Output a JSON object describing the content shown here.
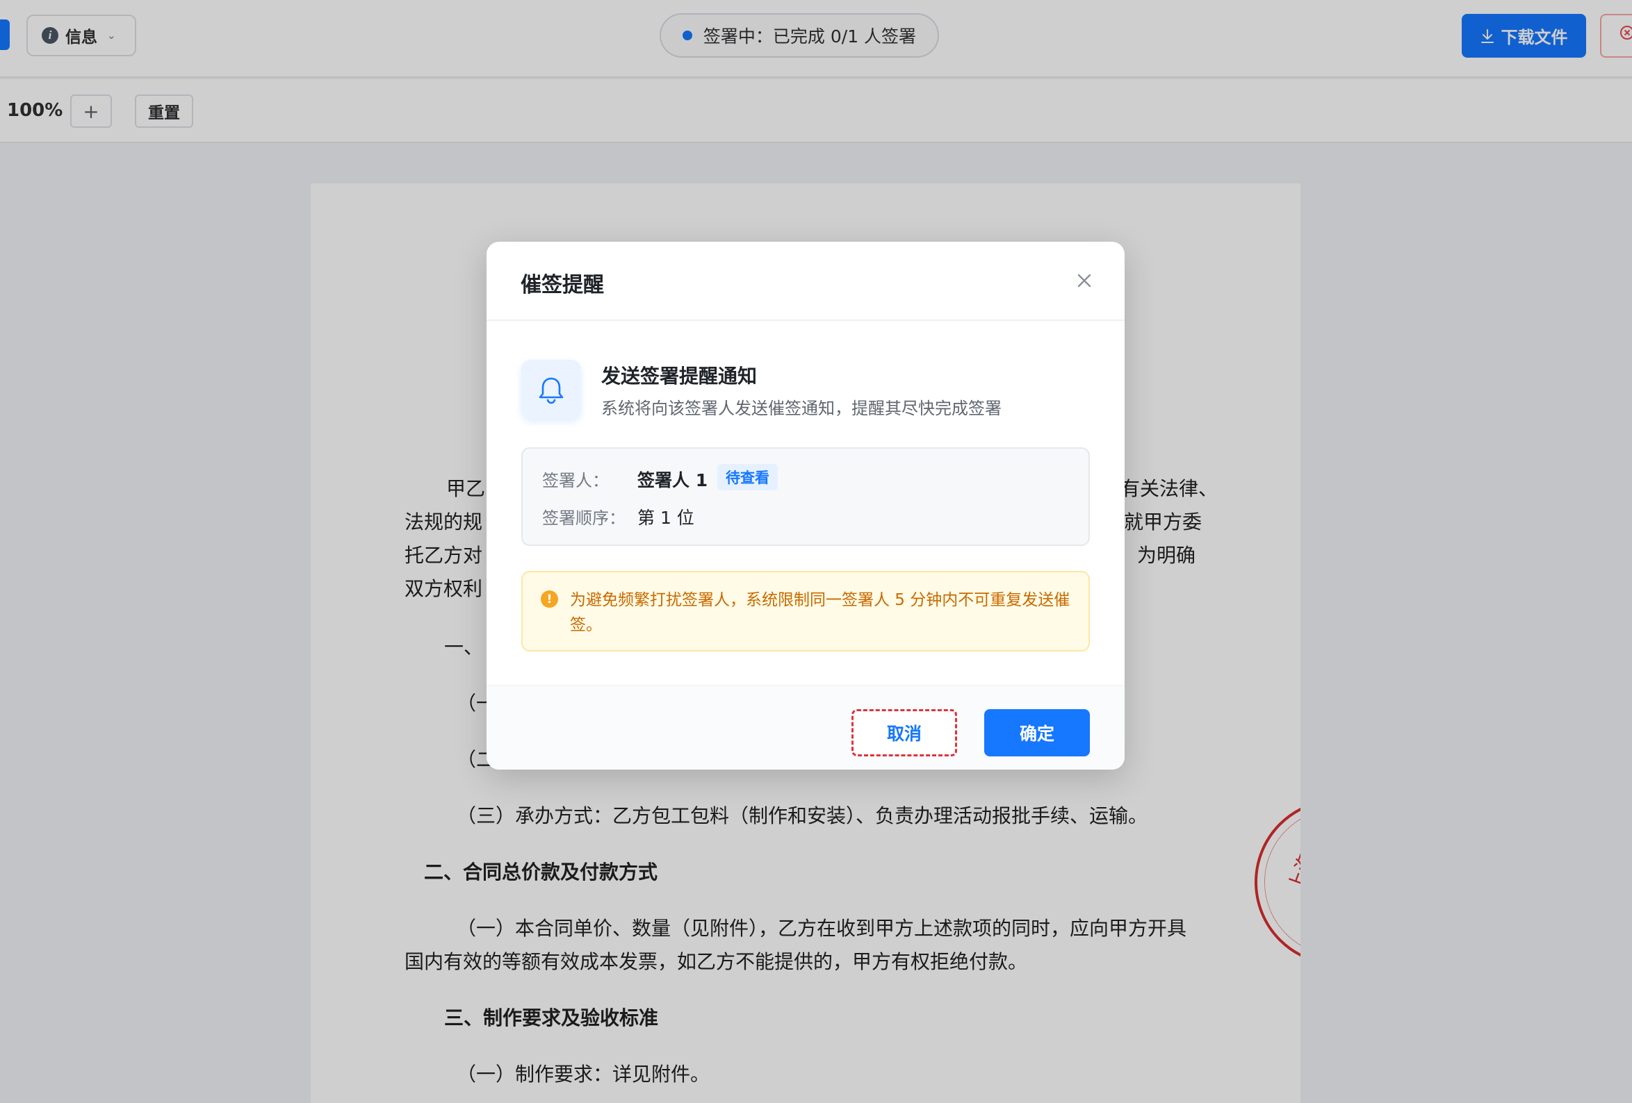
{
  "topbar": {
    "info_label": "信息",
    "status_text": "签署中：已完成 0/1 人签署",
    "download_label": "下载文件"
  },
  "toolbar": {
    "zoom_level": "100%",
    "zoom_in_symbol": "+",
    "reset_label": "重置"
  },
  "document": {
    "lines": [
      "甲乙",
      "有关法律、",
      "法规的规",
      "就甲方委",
      "托乙方对",
      "为明确",
      "双方权利",
      "一、",
      "（一",
      "（二",
      "（三）承办方式：乙方包工包料（制作和安装）、负责办理活动报批手续、运输。",
      "二、合同总价款及付款方式",
      "（一）本合同单价、数量（见附件），乙方在收到甲方上述款项的同时，应向甲方开具",
      "国内有效的等额有效成本发票，如乙方不能提供的，甲方有权拒绝付款。",
      "三、制作要求及验收标准",
      "（一）制作要求：详见附件。"
    ],
    "seal_text": "上海一"
  },
  "modal": {
    "title": "催签提醒",
    "notice_title": "发送签署提醒通知",
    "notice_desc": "系统将向该签署人发送催签通知，提醒其尽快完成签署",
    "signer_label": "签署人：",
    "signer_name": "签署人 1",
    "signer_status": "待查看",
    "order_label": "签署顺序：",
    "order_value": "第 1 位",
    "warning_text": "为避免频繁打扰签署人，系统限制同一签署人 5 分钟内不可重复发送催签。",
    "cancel_label": "取消",
    "confirm_label": "确定"
  }
}
